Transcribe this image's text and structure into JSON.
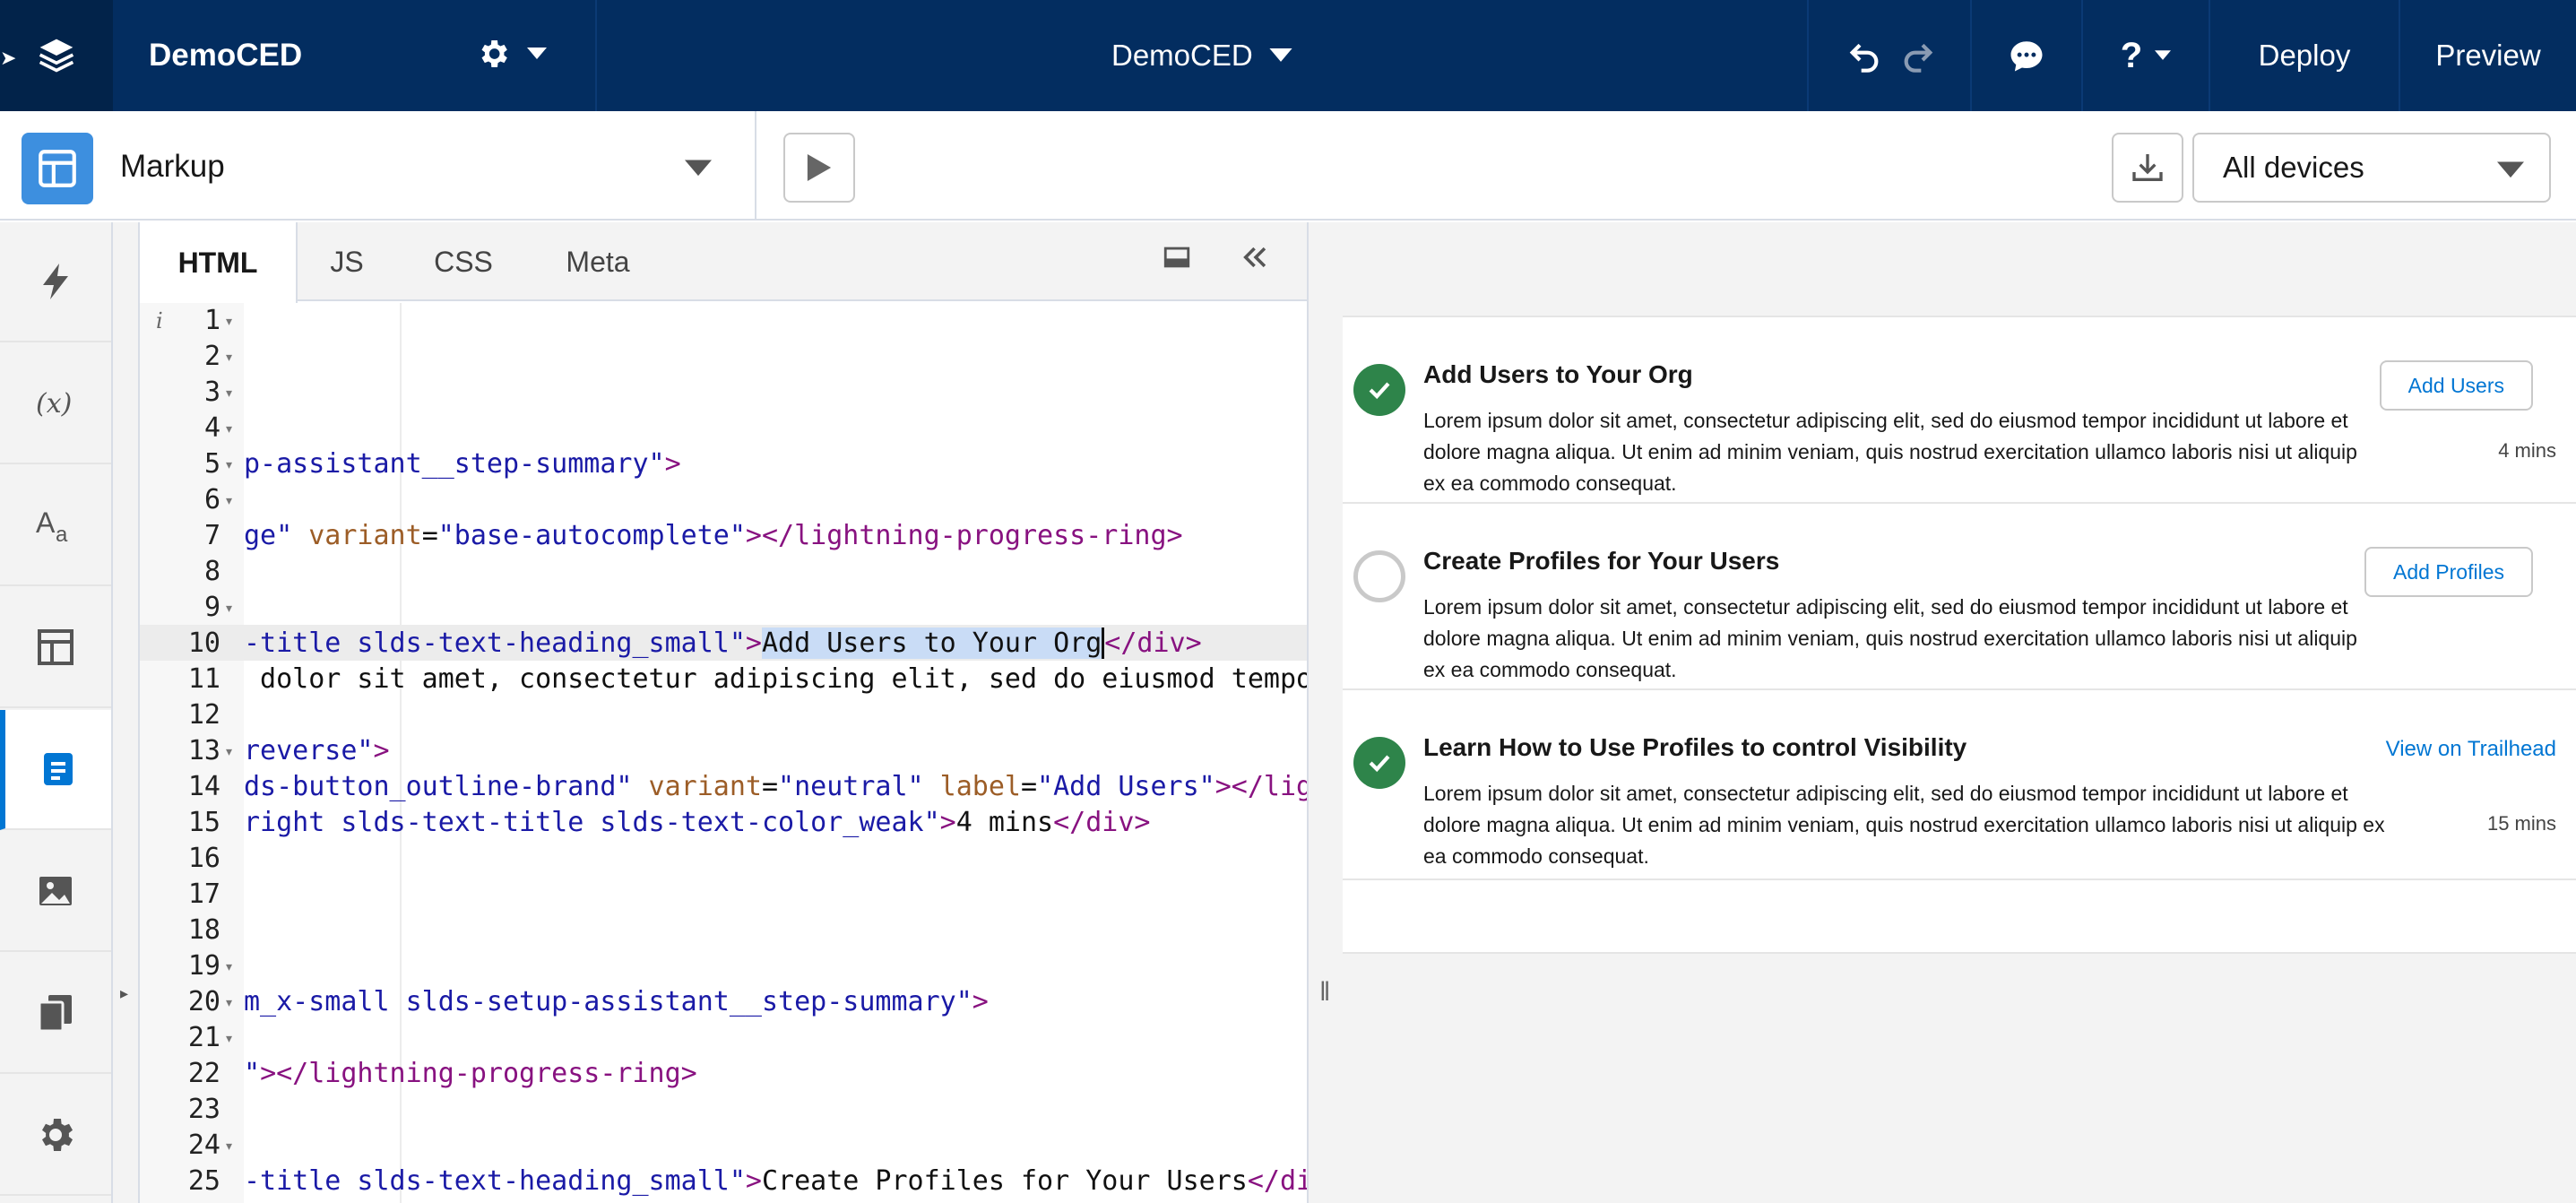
{
  "topbar": {
    "app_name": "DemoCED",
    "center_title": "DemoCED",
    "deploy_label": "Deploy",
    "preview_label": "Preview",
    "help_label": "?"
  },
  "toolbar": {
    "markup_label": "Markup",
    "device_select_value": "All devices"
  },
  "editor": {
    "tabs": [
      {
        "label": "HTML",
        "active": true
      },
      {
        "label": "JS",
        "active": false
      },
      {
        "label": "CSS",
        "active": false
      },
      {
        "label": "Meta",
        "active": false
      }
    ],
    "info_marker": "i",
    "line_numbers": [
      "1",
      "2",
      "3",
      "4",
      "5",
      "6",
      "7",
      "8",
      "9",
      "10",
      "11",
      "12",
      "13",
      "14",
      "15",
      "16",
      "17",
      "18",
      "19",
      "20",
      "21",
      "22",
      "23",
      "24",
      "25"
    ],
    "code": {
      "l5a": "p-assistant__step-summary\"",
      "l5b": ">",
      "l7a": "ge\"",
      "l7b": " variant",
      "l7c": "=",
      "l7d": "\"base-autocomplete\"",
      "l7e": "></lightning-progress-ring>",
      "l10a": "-title slds-text-heading_small\"",
      "l10b": ">",
      "l10c": "Add Users to Your Org",
      "l10d": "</div>",
      "l11a": " dolor sit amet, consectetur adipiscing elit, sed do eiusmod tempo",
      "l13a": "reverse\"",
      "l13b": ">",
      "l14a": "ds-button_outline-brand\"",
      "l14b": " variant",
      "l14c": "=",
      "l14d": "\"neutral\"",
      "l14e": " label",
      "l14f": "=",
      "l14g": "\"Add Users\"",
      "l14h": "></lig",
      "l15a": "right slds-text-title slds-text-color_weak\"",
      "l15b": ">",
      "l15c": "4 mins",
      "l15d": "</div>",
      "l20a": "m_x-small slds-setup-assistant__step-summary\"",
      "l20b": ">",
      "l22a": "\"",
      "l22b": "></lightning-progress-ring>",
      "l25a": "-title slds-text-heading_small\"",
      "l25b": ">",
      "l25c": "Create Profiles for Your Users",
      "l25d": "</di"
    }
  },
  "preview": {
    "steps": [
      {
        "title": "Add Users to Your Org",
        "body": "Lorem ipsum dolor sit amet, consectetur adipiscing elit, sed do eiusmod tempor incididunt ut labore et dolore magna aliqua. Ut enim ad minim veniam, quis nostrud exercitation ullamco laboris nisi ut aliquip ex ea commodo consequat.",
        "action": "Add Users",
        "time": "4 mins",
        "status": "complete"
      },
      {
        "title": "Create Profiles for Your Users",
        "body": "Lorem ipsum dolor sit amet, consectetur adipiscing elit, sed do eiusmod tempor incididunt ut labore et dolore magna aliqua. Ut enim ad minim veniam, quis nostrud exercitation ullamco laboris nisi ut aliquip ex ea commodo consequat.",
        "action": "Add Profiles",
        "time": "",
        "status": "not-started"
      },
      {
        "title": "Learn How to Use Profiles to control Visibility",
        "body": "Lorem ipsum dolor sit amet, consectetur adipiscing elit, sed do eiusmod tempor incididunt ut labore et dolore magna aliqua. Ut enim ad minim veniam, quis nostrud exercitation ullamco laboris nisi ut aliquip ex ea commodo consequat.",
        "action": "View on Trailhead",
        "time": "15 mins",
        "status": "complete"
      }
    ]
  },
  "colors": {
    "topbar_bg": "#032d60",
    "brand_blue": "#0176d3",
    "success_green": "#2e844a"
  },
  "icons": {
    "sidebar": [
      "lightning-bolt-icon",
      "formula-icon",
      "text-format-icon",
      "layout-icon",
      "document-icon",
      "image-icon",
      "copy-icon",
      "gear-icon"
    ]
  }
}
